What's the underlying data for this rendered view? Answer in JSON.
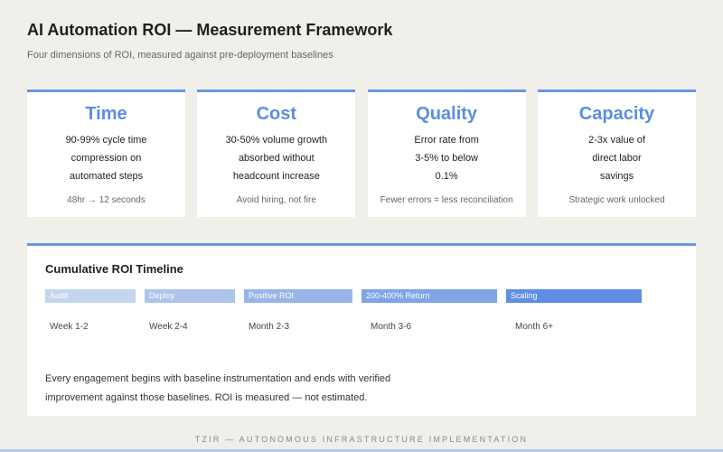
{
  "header": {
    "title": "AI Automation ROI — Measurement Framework",
    "subtitle": "Four dimensions of ROI, measured against pre-deployment baselines"
  },
  "colors": {
    "accent": "#6b95e0",
    "title_blue": "#5b8ee0",
    "background": "#f0efe9"
  },
  "cards": [
    {
      "title": "Time",
      "lines": [
        "90-99% cycle time",
        "compression on",
        "automated steps"
      ],
      "note": "48hr → 12 seconds"
    },
    {
      "title": "Cost",
      "lines": [
        "30-50% volume growth",
        "absorbed without",
        "headcount increase"
      ],
      "note": "Avoid hiring, not fire"
    },
    {
      "title": "Quality",
      "lines": [
        "Error rate from",
        "3-5% to below",
        "0.1%"
      ],
      "note": "Fewer errors = less reconciliation"
    },
    {
      "title": "Capacity",
      "lines": [
        "2-3x value of",
        "direct labor",
        "savings"
      ],
      "note": "Strategic work unlocked"
    }
  ],
  "timeline": {
    "title": "Cumulative ROI Timeline",
    "phases": [
      {
        "label": "Audit",
        "when": "Week 1-2",
        "color": "#c5d4ef"
      },
      {
        "label": "Deploy",
        "when": "Week 2-4",
        "color": "#aec4ec"
      },
      {
        "label": "Positive ROI",
        "when": "Month 2-3",
        "color": "#97b5e9"
      },
      {
        "label": "200-400% Return",
        "when": "Month 3-6",
        "color": "#80a5e6"
      },
      {
        "label": "Scaling",
        "when": "Month 6+",
        "color": "#5f8ee3"
      }
    ],
    "text_lines": [
      "Every engagement begins with baseline instrumentation and ends with verified",
      "improvement against those baselines. ROI is measured — not estimated."
    ]
  },
  "footer": {
    "text": "TZIR — AUTONOMOUS INFRASTRUCTURE IMPLEMENTATION"
  }
}
